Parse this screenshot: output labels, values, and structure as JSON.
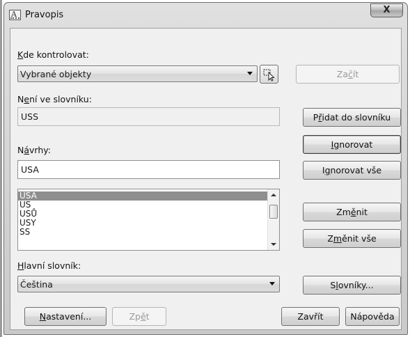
{
  "window": {
    "title": "Pravopis",
    "close_glyph": "X",
    "app_icon": "spell-check-icon"
  },
  "check_where": {
    "label_prefix": "K",
    "label_rest": "de kontrolovat:",
    "value": "Vybrané objekty",
    "select_icon": "select-objects-icon"
  },
  "start_button": {
    "pre": "Za",
    "u": "č",
    "post": "ít"
  },
  "not_in_dictionary": {
    "label_pre": "N",
    "label_u": "e",
    "label_post": "ní ve slovníku:",
    "value": "USS"
  },
  "add_button": {
    "pre": "P",
    "u": "ř",
    "post": "idat do slovníku"
  },
  "ignore_button": {
    "pre": "",
    "u": "I",
    "post": "gnorovat"
  },
  "ignore_all_button": {
    "pre": "I",
    "u": "g",
    "post": "norovat vše"
  },
  "suggestions": {
    "label_pre": "N",
    "label_u": "á",
    "label_post": "vrhy:",
    "value": "USA",
    "items": [
      "USA",
      "US",
      "USŮ",
      "USY",
      "SS"
    ],
    "selected_index": 0
  },
  "change_button": {
    "pre": "Zm",
    "u": "ě",
    "post": "nit"
  },
  "change_all_button": {
    "pre": "Z",
    "u": "m",
    "post": "ěnit vše"
  },
  "main_dictionary": {
    "label_pre": "",
    "label_u": "H",
    "label_post": "lavní slovník:",
    "value": "Čeština"
  },
  "dictionaries_button": {
    "pre": "S",
    "u": "l",
    "post": "ovníky..."
  },
  "settings_button": {
    "pre": "",
    "u": "N",
    "post": "astavení..."
  },
  "undo_button": {
    "pre": "Zp",
    "u": "ě",
    "post": "t"
  },
  "close_button": {
    "label": "Zavřít"
  },
  "help_button": {
    "label": "Nápověda"
  },
  "colors": {
    "selected_row": "#8e8e8e",
    "window_bg": "#f0f0f0"
  }
}
